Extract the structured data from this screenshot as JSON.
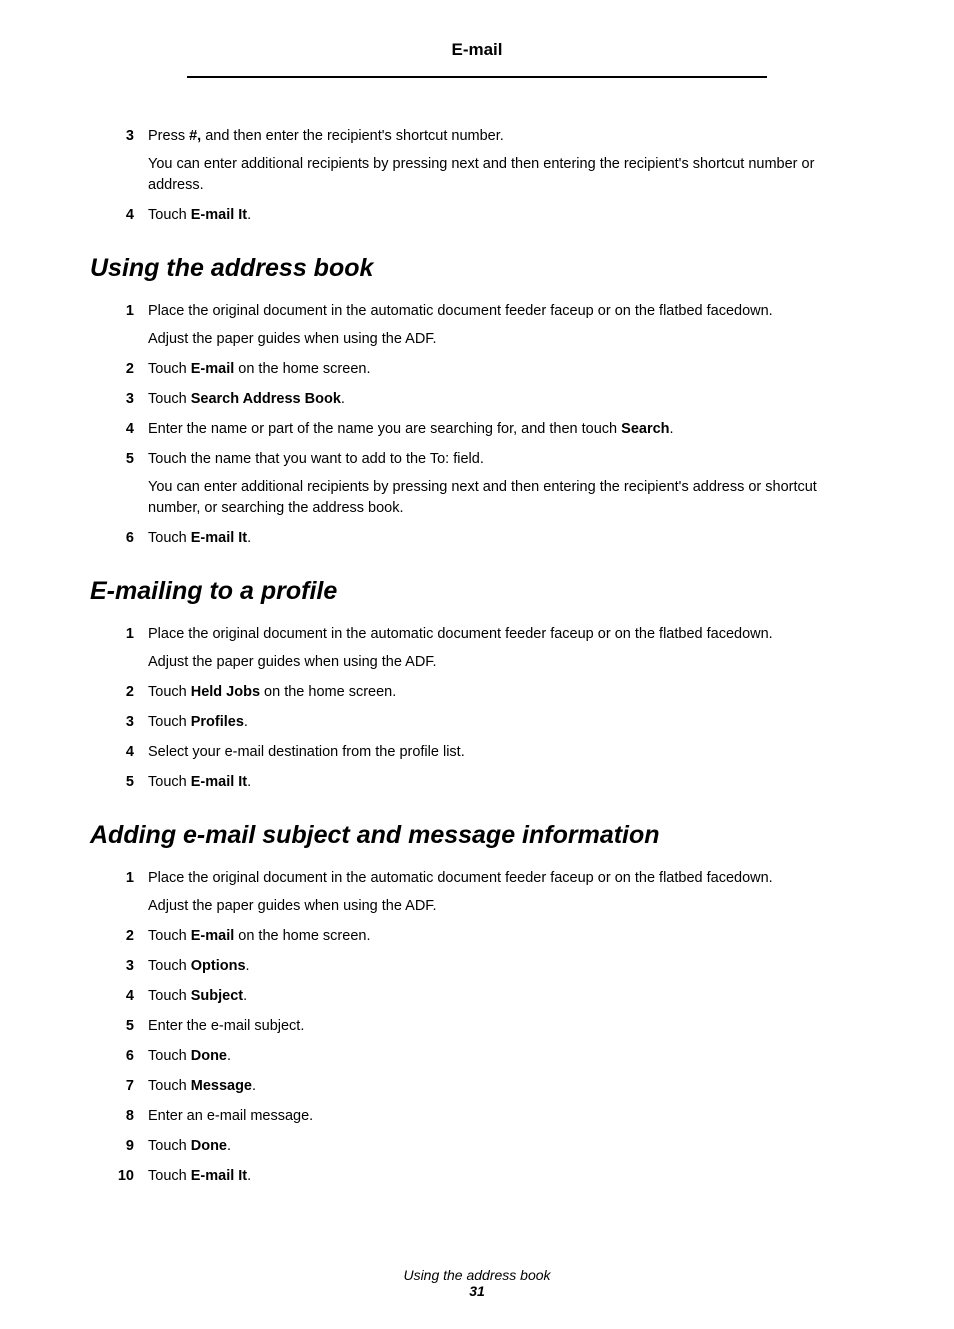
{
  "header": {
    "title": "E-mail"
  },
  "intro_steps": [
    {
      "num": "3",
      "lines": [
        "Press <b>#,</b> and then enter the recipient's shortcut number.",
        "You can enter additional recipients by pressing next and then entering the recipient's shortcut number or address."
      ]
    },
    {
      "num": "4",
      "lines": [
        "Touch <b>E-mail It</b>."
      ]
    }
  ],
  "sections": [
    {
      "heading": "Using the address book",
      "steps": [
        {
          "num": "1",
          "lines": [
            "Place the original document in the automatic document feeder faceup or on the flatbed facedown.",
            "Adjust the paper guides when using the ADF."
          ]
        },
        {
          "num": "2",
          "lines": [
            "Touch <b>E-mail</b> on the home screen."
          ]
        },
        {
          "num": "3",
          "lines": [
            "Touch <b>Search Address Book</b>."
          ]
        },
        {
          "num": "4",
          "lines": [
            "Enter the name or part of the name you are searching for, and then touch <b>Search</b>."
          ]
        },
        {
          "num": "5",
          "lines": [
            "Touch the name that you want to add to the To: field.",
            "You can enter additional recipients by pressing next and then entering the recipient's address or shortcut number, or searching the address book."
          ]
        },
        {
          "num": "6",
          "lines": [
            "Touch <b>E-mail It</b>."
          ]
        }
      ]
    },
    {
      "heading": "E-mailing to a profile",
      "steps": [
        {
          "num": "1",
          "lines": [
            "Place the original document in the automatic document feeder faceup or on the flatbed facedown.",
            "Adjust the paper guides when using the ADF."
          ]
        },
        {
          "num": "2",
          "lines": [
            "Touch <b>Held Jobs</b> on the home screen."
          ]
        },
        {
          "num": "3",
          "lines": [
            "Touch <b>Profiles</b>."
          ]
        },
        {
          "num": "4",
          "lines": [
            "Select your e-mail destination from the profile list."
          ]
        },
        {
          "num": "5",
          "lines": [
            "Touch <b>E-mail It</b>."
          ]
        }
      ]
    },
    {
      "heading": "Adding e-mail subject and message information",
      "steps": [
        {
          "num": "1",
          "lines": [
            "Place the original document in the automatic document feeder faceup or on the flatbed facedown.",
            "Adjust the paper guides when using the ADF."
          ]
        },
        {
          "num": "2",
          "lines": [
            "Touch <b>E-mail</b> on the home screen."
          ]
        },
        {
          "num": "3",
          "lines": [
            "Touch <b>Options</b>."
          ]
        },
        {
          "num": "4",
          "lines": [
            "Touch <b>Subject</b>."
          ]
        },
        {
          "num": "5",
          "lines": [
            "Enter the e-mail subject."
          ]
        },
        {
          "num": "6",
          "lines": [
            "Touch <b>Done</b>."
          ]
        },
        {
          "num": "7",
          "lines": [
            "Touch <b>Message</b>."
          ]
        },
        {
          "num": "8",
          "lines": [
            "Enter an e-mail message."
          ]
        },
        {
          "num": "9",
          "lines": [
            "Touch <b>Done</b>."
          ]
        },
        {
          "num": "10",
          "lines": [
            "Touch <b>E-mail It</b>."
          ]
        }
      ]
    }
  ],
  "footer": {
    "title": "Using the address book",
    "page": "31"
  }
}
